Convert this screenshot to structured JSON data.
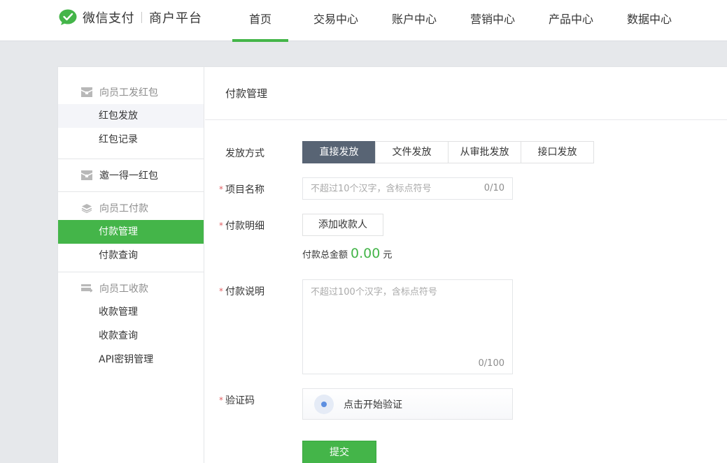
{
  "header": {
    "brand": "微信支付",
    "platform": "商户平台",
    "nav": [
      {
        "label": "首页",
        "active": true
      },
      {
        "label": "交易中心"
      },
      {
        "label": "账户中心"
      },
      {
        "label": "营销中心"
      },
      {
        "label": "产品中心"
      },
      {
        "label": "数据中心"
      }
    ]
  },
  "sidebar": {
    "groups": [
      {
        "title": "向员工发红包",
        "icon": "red-packet-icon",
        "items": [
          "红包发放",
          "红包记录"
        ]
      },
      {
        "title": "邀一得一红包",
        "icon": "red-packet-icon",
        "items": []
      },
      {
        "title": "向员工付款",
        "icon": "layers-icon",
        "items": [
          "付款管理",
          "付款查询"
        ]
      },
      {
        "title": "向员工收款",
        "icon": "card-icon",
        "items": [
          "收款管理",
          "收款查询",
          "API密钥管理"
        ]
      }
    ]
  },
  "content": {
    "title": "付款管理",
    "method_label": "发放方式",
    "methods": [
      "直接发放",
      "文件发放",
      "从审批发放",
      "接口发放"
    ],
    "project_label": "项目名称",
    "project_placeholder": "不超过10个汉字，含标点符号",
    "project_counter": "0/10",
    "detail_label": "付款明细",
    "add_payee": "添加收款人",
    "total_label": "付款总金额",
    "total_amount": "0.00",
    "total_unit": "元",
    "desc_label": "付款说明",
    "desc_placeholder": "不超过100个汉字，含标点符号",
    "desc_counter": "0/100",
    "captcha_label": "验证码",
    "captcha_text": "点击开始验证",
    "submit": "提交",
    "required_mark": "*"
  },
  "colors": {
    "brand_green": "#44b549",
    "segment_active": "#586474",
    "required": "#e15f63"
  }
}
